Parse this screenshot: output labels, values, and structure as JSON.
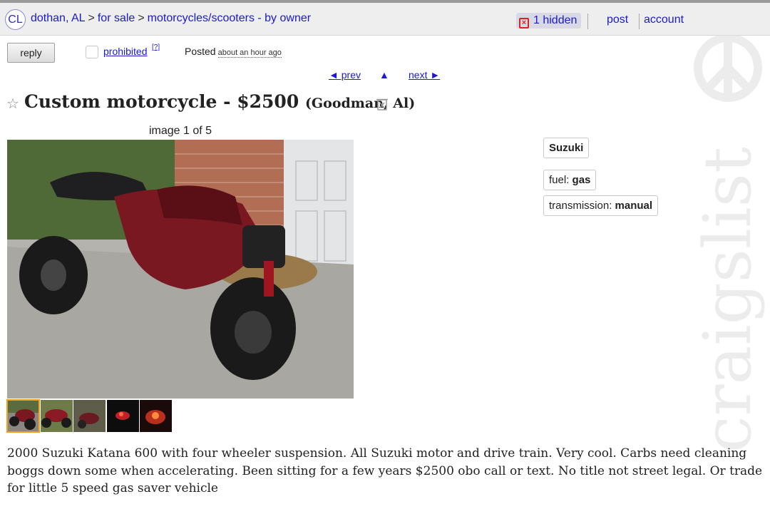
{
  "header": {
    "logo": "CL",
    "breadcrumbs": [
      {
        "label": "dothan, AL"
      },
      {
        "label": "for sale"
      },
      {
        "label": "motorcycles/scooters - by owner"
      }
    ],
    "hidden_label": "1 hidden",
    "post_label": "post",
    "account_label": "account"
  },
  "actions": {
    "reply_label": "reply",
    "prohibited_label": "prohibited",
    "prohibited_help": "[?]",
    "posted_label": "Posted",
    "posted_when": "about an hour ago"
  },
  "nav": {
    "prev_label": "◄ prev",
    "up_label": "▲",
    "next_label": "next ►"
  },
  "posting": {
    "title": "Custom motorcycle",
    "price": "$2500",
    "location": "(Goodman, Al)",
    "image_counter": "image 1 of 5",
    "body": "2000 Suzuki Katana 600 with four wheeler suspension. All Suzuki motor and drive train. Very cool. Carbs need cleaning boggs down some when accelerating. Been sitting for a few years $2500 obo call or text. No title not street legal. Or trade for little 5 speed gas saver vehicle"
  },
  "attributes": {
    "make": "Suzuki",
    "fuel_label": "fuel:",
    "fuel_value": "gas",
    "transmission_label": "transmission:",
    "transmission_value": "manual"
  },
  "watermark_text": "craigslist",
  "colors": {
    "link": "#1a1acf",
    "header_bg": "#eeeeee",
    "thumb_selected": "#f0a020",
    "hidden_icon": "#e02020"
  }
}
